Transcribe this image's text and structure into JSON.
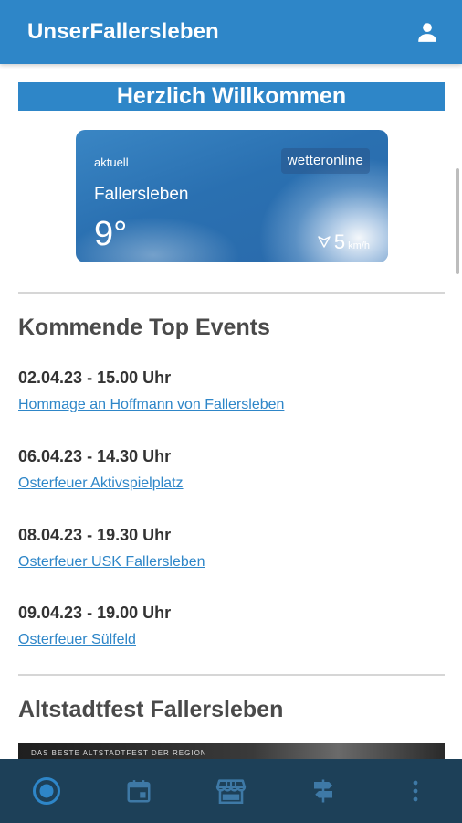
{
  "app": {
    "title": "UnserFallersleben",
    "user_icon": "person-icon"
  },
  "welcome": {
    "title": "Herzlich Willkommen"
  },
  "weather": {
    "current_label": "aktuell",
    "brand": "wetteronline",
    "city": "Fallersleben",
    "temperature": "9°",
    "wind_icon": "wind-direction-icon",
    "wind_value": "5",
    "wind_unit": "km/h"
  },
  "events_section": {
    "title": "Kommende Top Events",
    "items": [
      {
        "date": "02.04.23 - 15.00 Uhr",
        "title": "Hommage an Hoffmann von Fallersleben"
      },
      {
        "date": "06.04.23 - 14.30 Uhr",
        "title": "Osterfeuer Aktivspielplatz"
      },
      {
        "date": "08.04.23 - 19.30 Uhr",
        "title": "Osterfeuer USK Fallersleben"
      },
      {
        "date": "09.04.23 - 19.00 Uhr",
        "title": "Osterfeuer Sülfeld"
      }
    ]
  },
  "altstadt_section": {
    "title": "Altstadtfest Fallersleben",
    "banner_text": "DAS BESTE ALTSTADTFEST DER REGION"
  },
  "bottom_nav": {
    "items": [
      {
        "icon": "home-circle-icon",
        "active": true
      },
      {
        "icon": "calendar-icon",
        "active": false
      },
      {
        "icon": "store-icon",
        "active": false
      },
      {
        "icon": "signpost-icon",
        "active": false
      },
      {
        "icon": "more-vertical-icon",
        "active": false
      }
    ]
  },
  "colors": {
    "primary": "#2e86c8",
    "nav_background": "#1d4058",
    "nav_active": "#2e86c8",
    "nav_inactive": "#3e79a6",
    "link": "#2e86c8"
  }
}
